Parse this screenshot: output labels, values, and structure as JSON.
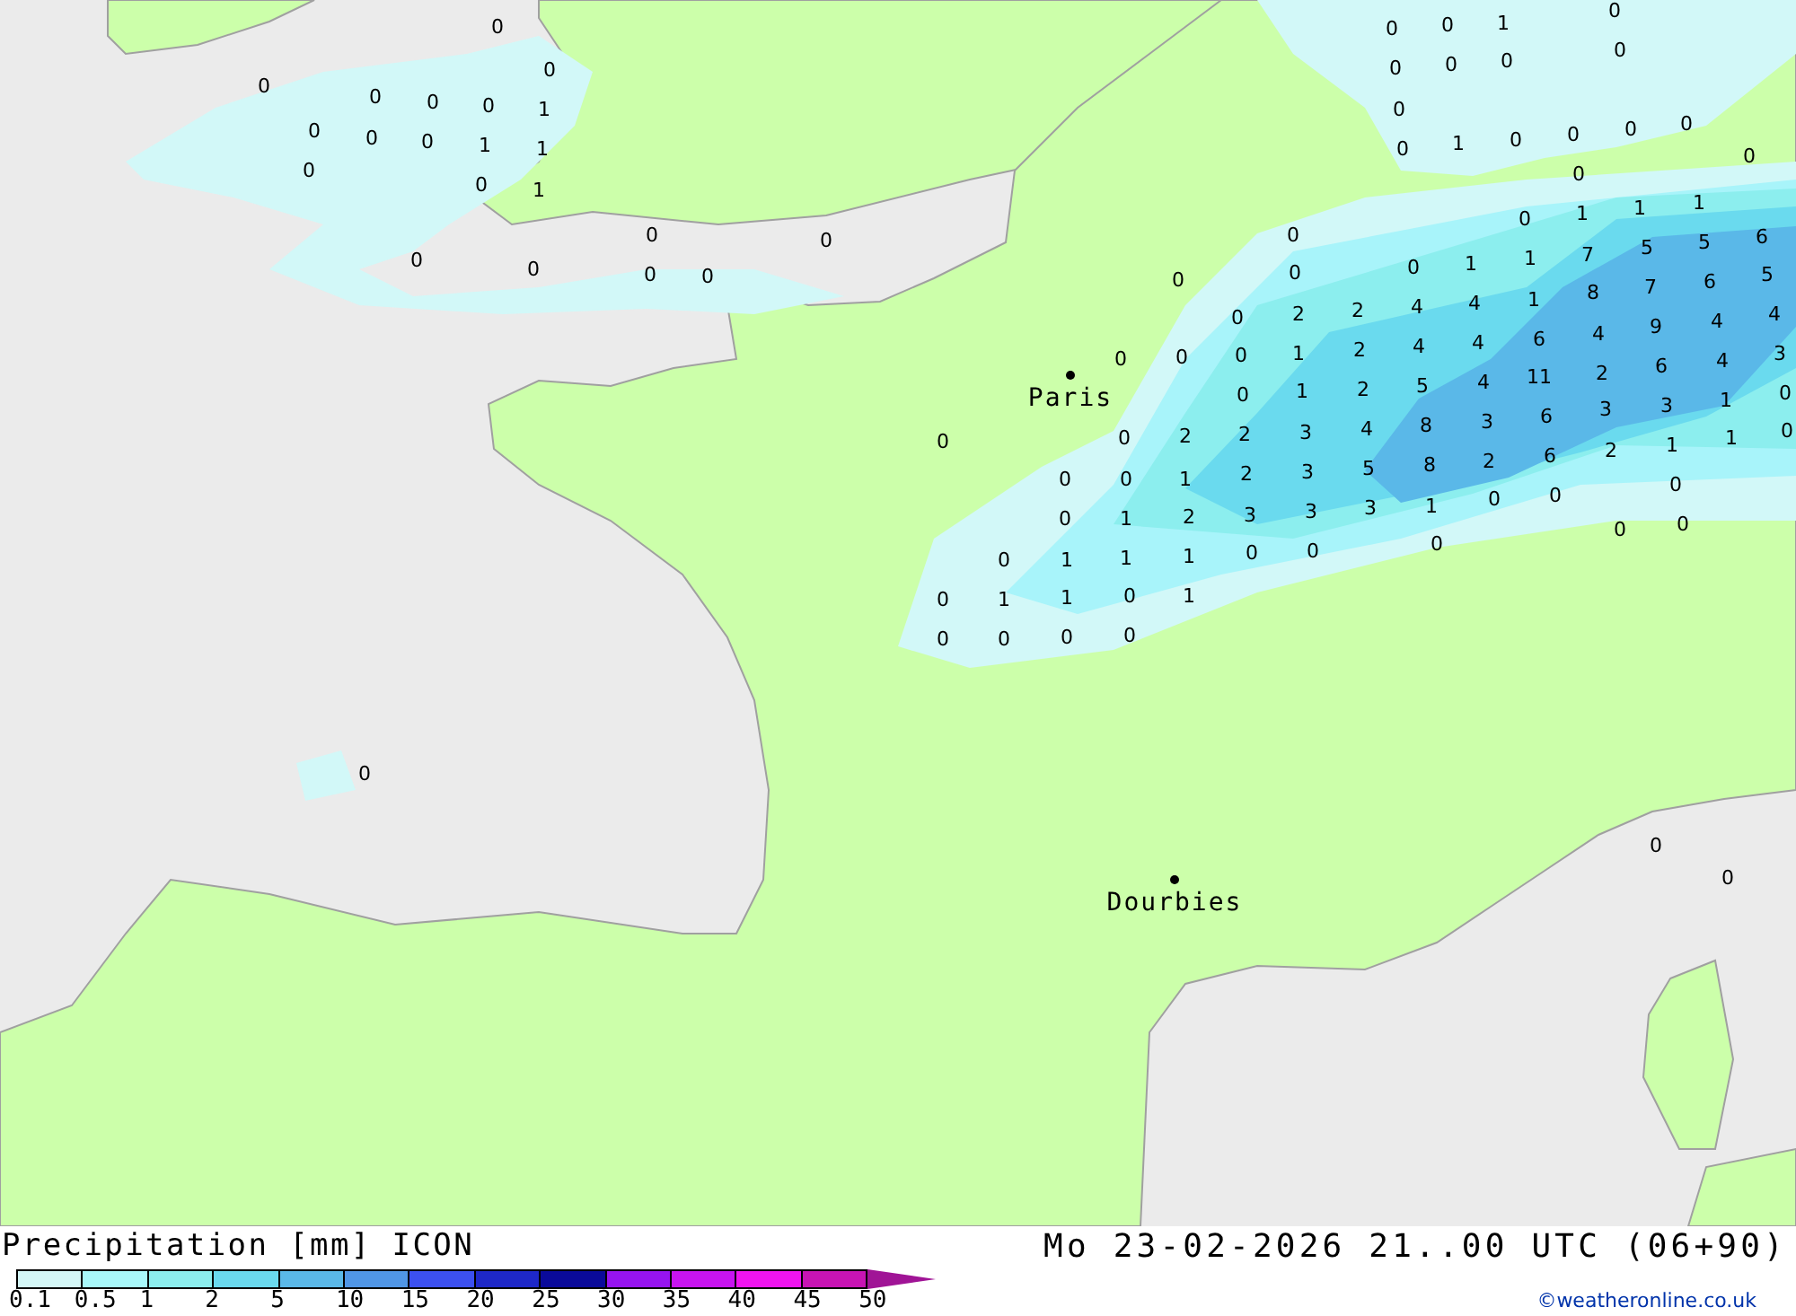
{
  "map": {
    "cities": [
      {
        "name": "Paris"
      },
      {
        "name": "Dourbies"
      }
    ],
    "precipitation_labels": [
      "0",
      "0",
      "1",
      "0",
      "0",
      "0",
      "0",
      "0",
      "0",
      "0",
      "0",
      "0",
      "0",
      "0",
      "1",
      "0",
      "0",
      "0",
      "0",
      "0",
      "0",
      "0",
      "0",
      "1",
      "1",
      "0",
      "1",
      "0",
      "0",
      "0",
      "0",
      "1",
      "1",
      "0",
      "1",
      "1",
      "0",
      "0",
      "0",
      "5",
      "5",
      "6",
      "0",
      "0",
      "0",
      "1",
      "1",
      "7",
      "0",
      "0",
      "0",
      "0",
      "7",
      "6",
      "5",
      "4",
      "4",
      "1",
      "8",
      "0",
      "2",
      "2",
      "9",
      "4",
      "4",
      "2",
      "4",
      "4",
      "6",
      "4",
      "0",
      "0",
      "0",
      "1",
      "6",
      "4",
      "3",
      "2",
      "5",
      "4",
      "11",
      "2",
      "0",
      "1",
      "3",
      "1",
      "0",
      "8",
      "3",
      "6",
      "3",
      "0",
      "0",
      "2",
      "2",
      "3",
      "4",
      "1",
      "1",
      "0",
      "8",
      "2",
      "6",
      "2",
      "0",
      "0",
      "1",
      "2",
      "3",
      "5",
      "0",
      "3",
      "3",
      "1",
      "0",
      "0",
      "0",
      "1",
      "2",
      "3",
      "0",
      "0",
      "0",
      "1",
      "1",
      "1",
      "0",
      "0",
      "0",
      "0",
      "1",
      "1",
      "0",
      "1",
      "0",
      "0",
      "0",
      "0",
      "0",
      "0",
      "0"
    ]
  },
  "legend": {
    "title": "Precipitation [mm] ICON",
    "scale_segments": [
      {
        "color": "#d4f7f7"
      },
      {
        "color": "#a8f8fa"
      },
      {
        "color": "#8ceeee"
      },
      {
        "color": "#6ad9ee"
      },
      {
        "color": "#5ab8e8"
      },
      {
        "color": "#5096e6"
      },
      {
        "color": "#3c50f0"
      },
      {
        "color": "#1e28c8"
      },
      {
        "color": "#0a0a9a"
      },
      {
        "color": "#9614f0"
      },
      {
        "color": "#c814f0"
      },
      {
        "color": "#f014f0"
      },
      {
        "color": "#c814b4"
      }
    ],
    "scale_ticks": [
      "0.1",
      "0.5",
      "1",
      "2",
      "5",
      "10",
      "15",
      "20",
      "25",
      "30",
      "35",
      "40",
      "45",
      "50"
    ],
    "valid_time": "Mo 23-02-2026 21..00 UTC (06+90)",
    "credit": "©weatheronline.co.uk"
  }
}
